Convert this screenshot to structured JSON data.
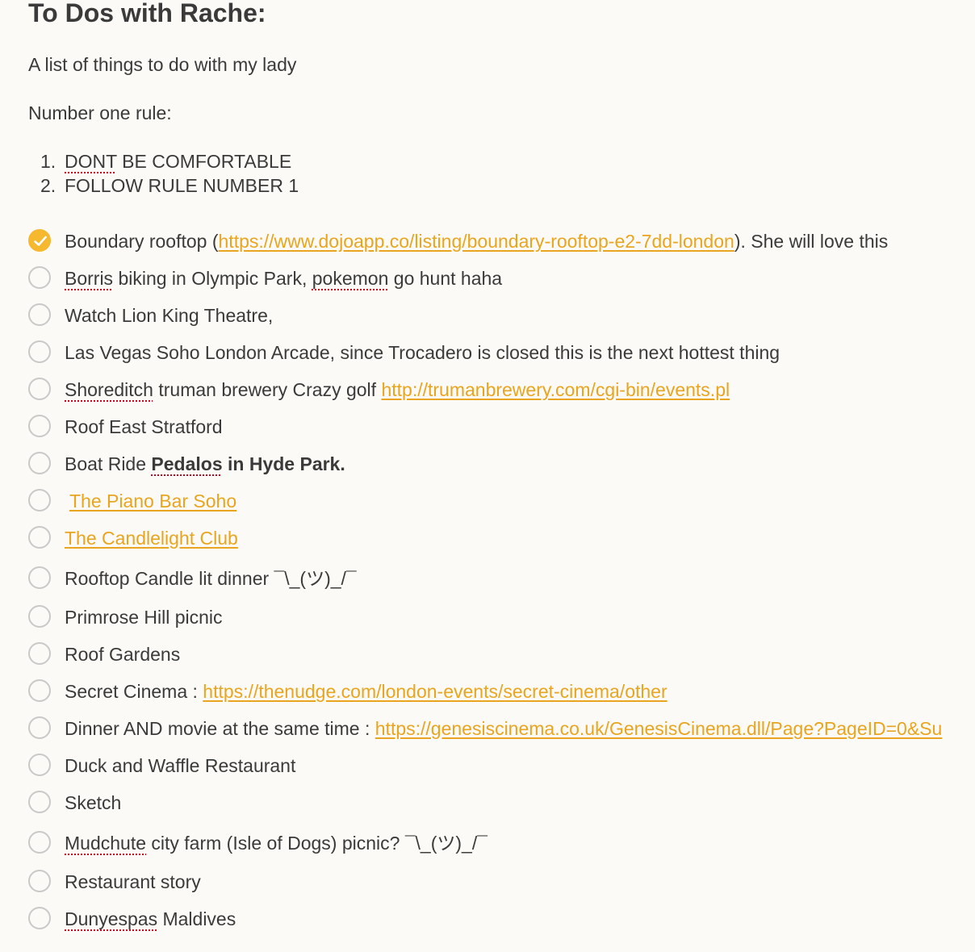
{
  "title": "To Dos with Rache:",
  "intro": "A list of things to do with my lady",
  "rule_heading": "Number one rule:",
  "rules": [
    {
      "num": "1.",
      "first": "DONT",
      "rest": " BE COMFORTABLE"
    },
    {
      "num": "2.",
      "text": "FOLLOW RULE NUMBER 1"
    }
  ],
  "colors": {
    "accent": "#f5b82e",
    "link": "#e9a51f",
    "text": "#3a3a3a",
    "unchecked_border": "#c9c9c9",
    "spellcheck": "#d0021b"
  },
  "icons": {
    "checked": "checkmark-circle-icon",
    "unchecked": "empty-circle-icon"
  },
  "todos": [
    {
      "checked": true,
      "text": "Boundary rooftop (",
      "link": "https://www.dojoapp.co/listing/boundary-rooftop-e2-7dd-london",
      "after": "). She will love this"
    },
    {
      "checked": false,
      "w1": "Borris",
      "t1": " biking in Olympic Park, ",
      "w2": "pokemon",
      "t2": " go hunt haha"
    },
    {
      "checked": false,
      "text": "Watch Lion King Theatre,"
    },
    {
      "checked": false,
      "text": "Las Vegas Soho London Arcade, since Trocadero is closed this is the next hottest thing"
    },
    {
      "checked": false,
      "w1": "Shoreditch",
      "t1": " truman brewery Crazy golf ",
      "link": "http://trumanbrewery.com/cgi-bin/events.pl"
    },
    {
      "checked": false,
      "text": "Roof East Stratford"
    },
    {
      "checked": false,
      "text": "Boat Ride ",
      "bold_word": "Pedalos",
      "bold_rest": " in Hyde Park."
    },
    {
      "checked": false,
      "link": "The Piano Bar Soho"
    },
    {
      "checked": false,
      "link": "The Candlelight Club"
    },
    {
      "checked": false,
      "text": "Rooftop Candle lit dinner ¯\\_(ツ)_/¯"
    },
    {
      "checked": false,
      "text": "Primrose Hill picnic"
    },
    {
      "checked": false,
      "text": "Roof Gardens"
    },
    {
      "checked": false,
      "text": "Secret Cinema : ",
      "link": "https://thenudge.com/london-events/secret-cinema/other"
    },
    {
      "checked": false,
      "text": "Dinner AND movie at the same time : ",
      "link": "https://genesiscinema.co.uk/GenesisCinema.dll/Page?PageID=0&Su"
    },
    {
      "checked": false,
      "text": "Duck and Waffle Restaurant"
    },
    {
      "checked": false,
      "text": "Sketch"
    },
    {
      "checked": false,
      "w1": "Mudchute",
      "t1": " city farm (Isle of Dogs) picnic? ¯\\_(ツ)_/¯"
    },
    {
      "checked": false,
      "text": "Restaurant story"
    },
    {
      "checked": false,
      "w1": "Dunyespas",
      "t1": " Maldives"
    }
  ]
}
